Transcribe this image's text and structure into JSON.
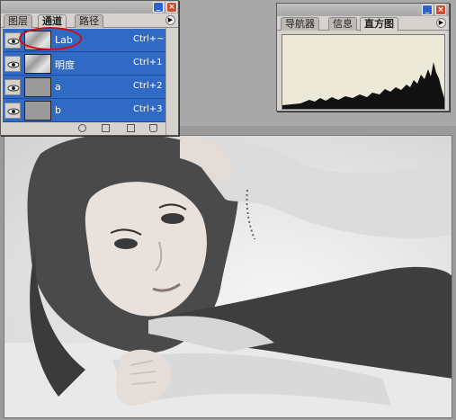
{
  "channels_panel": {
    "tabs": [
      "图层",
      "通道",
      "路径"
    ],
    "active_tab": 1,
    "rows": [
      {
        "name": "Lab",
        "shortcut": "Ctrl+~",
        "thumb": "image"
      },
      {
        "name": "明度",
        "shortcut": "Ctrl+1",
        "thumb": "image"
      },
      {
        "name": "a",
        "shortcut": "Ctrl+2",
        "thumb": "flat"
      },
      {
        "name": "b",
        "shortcut": "Ctrl+3",
        "thumb": "flat"
      }
    ]
  },
  "histogram_panel": {
    "tabs": [
      "导航器",
      "信息",
      "直方图"
    ],
    "active_tab": 2
  },
  "colors": {
    "selection": "#316ac5",
    "highlight_ring": "#d01010",
    "panel_bg": "#d6d3ce"
  },
  "icons": [
    "eye-icon",
    "minimize-icon",
    "close-icon",
    "palette-menu-icon",
    "load-selection-icon",
    "save-selection-icon",
    "new-channel-icon",
    "trash-icon"
  ]
}
